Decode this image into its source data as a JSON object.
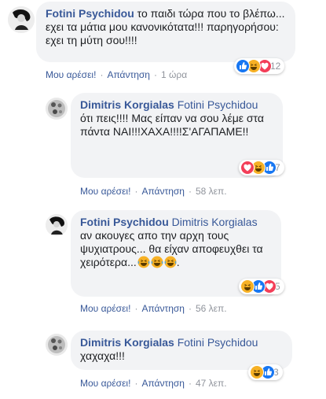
{
  "comments": [
    {
      "author": "Fotini Psychidou",
      "mention": "",
      "text": "το παιδι τώρα που το βλέπω... εχει τα μάτια μου κανονικότατα!!! παρηγορήσου: εχει τη μύτη σου!!!!",
      "like_label": "Μου αρέσει!",
      "reply_label": "Απάντηση",
      "time": "1 ώρα",
      "reaction_icons": [
        "like-icon",
        "haha-icon",
        "love-icon"
      ],
      "reaction_count": "12"
    },
    {
      "author": "Dimitris Korgialas",
      "mention": "Fotini Psychidou",
      "text": "ότι πεις!!!! Μας είπαν να σου λέμε στα πάντα ΝΑΙ!!!ΧΑΧΑ!!!!Σ'ΑΓΑΠΑΜΕ!!",
      "like_label": "Μου αρέσει!",
      "reply_label": "Απάντηση",
      "time": "58 λεπ.",
      "reaction_icons": [
        "love-icon",
        "haha-icon",
        "like-icon"
      ],
      "reaction_count": "7"
    },
    {
      "author": "Fotini Psychidou",
      "mention": "Dimitris Korgialas",
      "text": "αν ακουγες απο την αρχη τους ψυχιατρους... θα είχαν αποφευχθει τα χειρότερα...",
      "trailing_emoji_count": 3,
      "like_label": "Μου αρέσει!",
      "reply_label": "Απάντηση",
      "time": "56 λεπ.",
      "reaction_icons": [
        "haha-icon",
        "like-icon",
        "love-icon"
      ],
      "reaction_count": "5"
    },
    {
      "author": "Dimitris Korgialas",
      "mention": "Fotini Psychidou",
      "text": "χαχαχα!!!",
      "like_label": "Μου αρέσει!",
      "reply_label": "Απάντηση",
      "time": "47 λεπ.",
      "reaction_icons": [
        "haha-icon",
        "like-icon"
      ],
      "reaction_count": "3"
    }
  ],
  "colors": {
    "link": "#385898",
    "bubble": "#f2f3f5",
    "meta": "#90949c",
    "like": "#1877f2",
    "love": "#f33e58",
    "haha": "#f7b125"
  }
}
